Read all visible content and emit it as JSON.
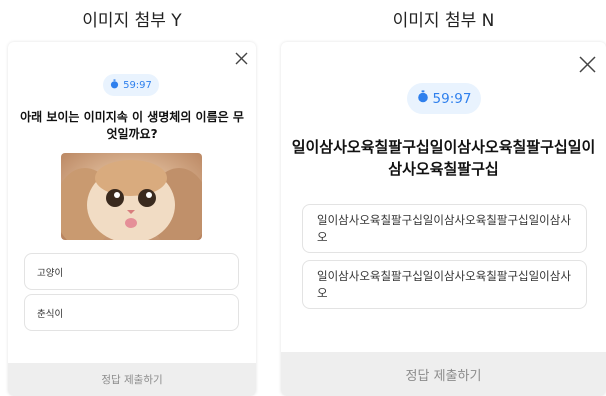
{
  "left": {
    "title": "이미지 첨부 Y",
    "timer": "59:97",
    "question": "아래 보이는 이미지속 이 생명체의 이름은 무엇일까요?",
    "options": [
      "고양이",
      "춘식이"
    ],
    "submit_label": "정답 제출하기"
  },
  "right": {
    "title": "이미지 첨부 N",
    "timer": "59:97",
    "question": "일이삼사오육칠팔구십일이삼사오육칠팔구십일이삼사오육칠팔구십",
    "options": [
      "일이삼사오육칠팔구십일이삼사오육칠팔구십일이삼사오",
      "일이삼사오육칠팔구십일이삼사오육칠팔구십일이삼사오"
    ],
    "submit_label": "정답 제출하기"
  },
  "icons": {
    "close": "close-icon",
    "timer": "stopwatch-icon",
    "image": "cat-photo"
  },
  "colors": {
    "timer_bg": "#e9f3fe",
    "timer_text": "#2f80ed",
    "submit_bg": "#eeeeee",
    "submit_text": "#8c8c8c"
  }
}
